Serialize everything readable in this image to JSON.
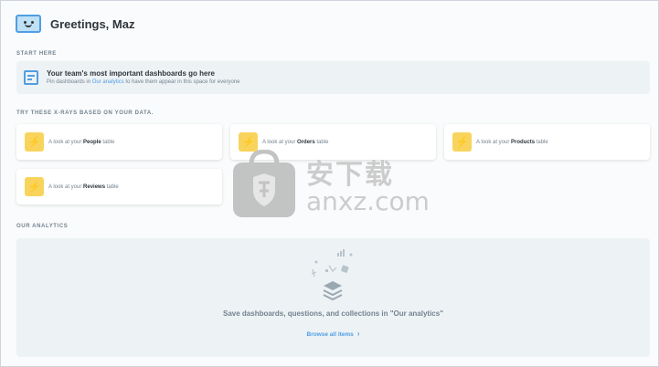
{
  "header": {
    "greeting": "Greetings, Maz",
    "mascot_icon": "smiley-monitor-icon"
  },
  "start_here": {
    "label": "START HERE",
    "banner_title": "Your team's most important dashboards go here",
    "banner_sub_prefix": "Pin dashboards in",
    "banner_sub_link": "Our analytics",
    "banner_sub_suffix": "to have them appear in this space for everyone",
    "icon": "dashboard-icon"
  },
  "xrays": {
    "label": "TRY THESE X-RAYS BASED ON YOUR DATA.",
    "items": [
      {
        "prefix": "A look at your",
        "table": "People",
        "suffix": "table"
      },
      {
        "prefix": "A look at your",
        "table": "Orders",
        "suffix": "table"
      },
      {
        "prefix": "A look at your",
        "table": "Products",
        "suffix": "table"
      },
      {
        "prefix": "A look at your",
        "table": "Reviews",
        "suffix": "table"
      }
    ],
    "icon": "bolt-icon"
  },
  "analytics": {
    "label": "OUR ANALYTICS",
    "empty_message": "Save dashboards, questions, and collections in \"Our analytics\"",
    "browse_label": "Browse all items",
    "browse_icon": "chevron-right-icon"
  },
  "watermark": {
    "cn": "安下载",
    "en": "anxz.com"
  },
  "colors": {
    "brand": "#509ee3",
    "xray": "#f9d45c",
    "banner_bg": "#edf2f5"
  }
}
